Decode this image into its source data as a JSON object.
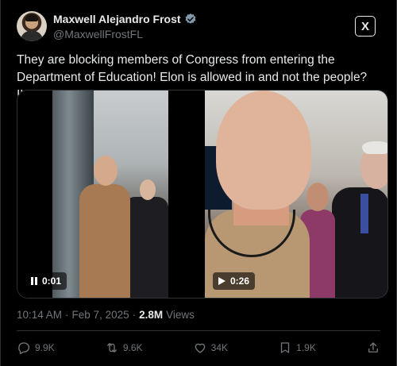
{
  "author": {
    "display_name": "Maxwell Alejandro Frost",
    "handle": "@MaxwellFrostFL",
    "verified": true
  },
  "header": {
    "x_logo_label": "X"
  },
  "tweet": {
    "text": "They are blocking members of Congress from entering the Department of Education! Elon is allowed in and not the people? ILLEGAL."
  },
  "media": [
    {
      "kind": "video",
      "time": "0:01",
      "state": "paused"
    },
    {
      "kind": "video",
      "time": "0:26",
      "state": "stopped"
    }
  ],
  "meta": {
    "time": "10:14 AM",
    "separator": "·",
    "date": "Feb 7, 2025",
    "views_count": "2.8M",
    "views_label": "Views"
  },
  "actions": {
    "replies": "9.9K",
    "reposts": "9.6K",
    "likes": "34K",
    "bookmarks": "1.9K"
  },
  "colors": {
    "background": "#000000",
    "text": "#e7e9ea",
    "muted": "#71767b",
    "verified": "#829aab",
    "border": "#2f3336"
  }
}
